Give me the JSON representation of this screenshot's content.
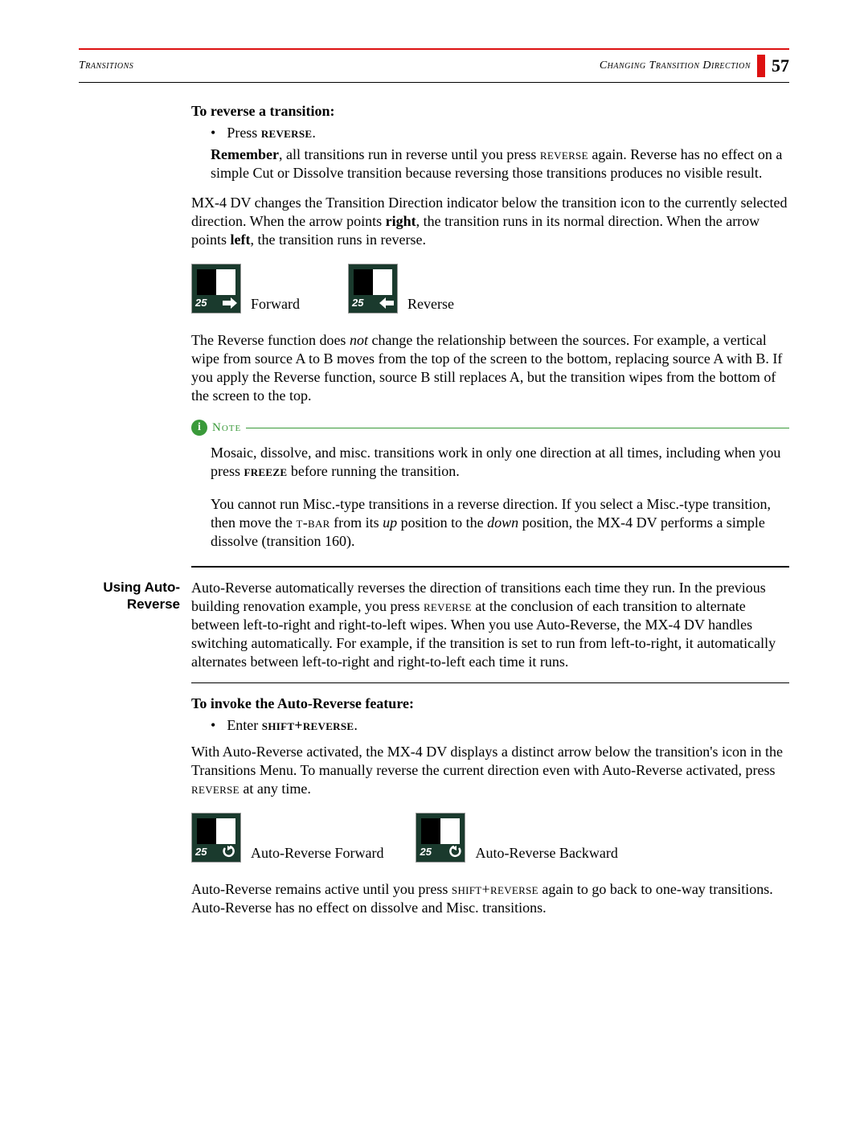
{
  "header": {
    "left": "Transitions",
    "right": "Changing Transition Direction",
    "page_number": "57"
  },
  "sec1": {
    "heading": "To reverse a transition:",
    "bullet_press": "Press ",
    "reverse_key": "reverse",
    "remember_label": "Remember",
    "remember_text1": ", all transitions run in reverse until you press ",
    "remember_text2": " again. Reverse has no effect on a simple Cut or Dissolve transition because reversing those transitions produces no visible result.",
    "para2a": "MX-4 DV changes the Transition Direction indicator below the transition icon to the currently selected direction. When the arrow points ",
    "right_word": "right",
    "para2b": ", the transition runs in its normal direction. When the arrow points ",
    "left_word": "left",
    "para2c": ", the transition runs in reverse."
  },
  "icons1": {
    "num": "25",
    "forward": "Forward",
    "reverse": "Reverse"
  },
  "para3a": "The Reverse function does ",
  "not_word": "not",
  "para3b": " change the relationship between the sources. For example, a vertical wipe from source A to B moves from the top of the screen to the bottom, replacing source A with B. If you apply the Reverse function, source B still replaces A, but the transition wipes from the bottom of the screen to the top.",
  "note": {
    "label": "Note",
    "p1a": "Mosaic, dissolve, and misc. transitions work in only one direction at all times, including when you press ",
    "freeze_key": "freeze",
    "p1b": " before running the transition.",
    "p2a": "You cannot run Misc.-type transitions in a reverse direction. If you select a Misc.-type transition, then move the ",
    "tbar_key": "t-bar",
    "p2b": " from its ",
    "up_word": "up",
    "p2c": " position to the ",
    "down_word": "down",
    "p2d": " position, the MX-4 DV performs a simple dissolve (transition 160)."
  },
  "sec2": {
    "callout": "Using Auto-Reverse",
    "p1a": "Auto-Reverse automatically reverses the direction of transitions each time they run. In the previous building renovation example, you press ",
    "p1b": " at the conclusion of each transition to alternate between left-to-right and right-to-left wipes. When you use Auto-Reverse, the MX-4 DV handles switching automatically. For example, if the transition is set to run from left-to-right, it automatically alternates between left-to-right and right-to-left each time it runs."
  },
  "sec3": {
    "heading": "To invoke the Auto-Reverse feature:",
    "bullet_enter": "Enter ",
    "shift_reverse": "shift+reverse",
    "p1a": "With Auto-Reverse activated, the MX-4 DV displays a distinct arrow below the transition's icon in the Transitions Menu. To manually reverse the current direction even with Auto-Reverse activated, press ",
    "p1b": " at any time."
  },
  "icons2": {
    "num": "25",
    "fwd": "Auto-Reverse Forward",
    "bwd": "Auto-Reverse Backward"
  },
  "para_last_a": "Auto-Reverse remains active until you press ",
  "para_last_b": " again to go back to one-way transitions. Auto-Reverse has no effect on dissolve and Misc. transitions."
}
